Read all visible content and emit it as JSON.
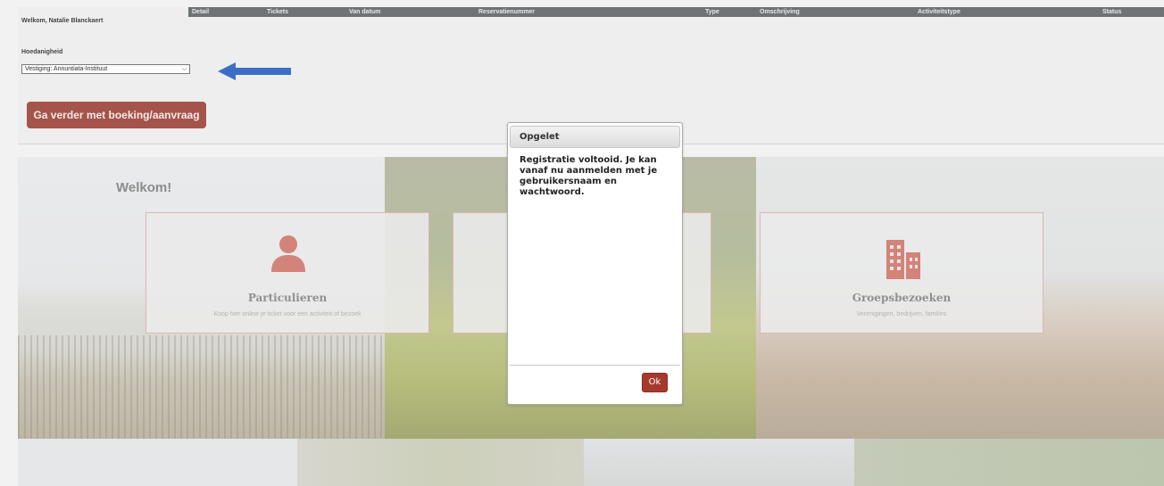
{
  "header": {
    "welcome": "Welkom, Natalie Blanckaert",
    "columns": [
      "Detail",
      "Tickets",
      "Van datum",
      "Reservatienummer",
      "Type",
      "Omschrijving",
      "Activiteitstype",
      "Status"
    ]
  },
  "form": {
    "quantity_label": "Hoedanigheid",
    "location_select": "Vestiging: Annuntiata-Instituut",
    "continue_label": "Ga verder met boeking/aanvraag"
  },
  "hero": {
    "welcome_title": "Welkom!",
    "cards": [
      {
        "title": "Particulieren",
        "subtitle": "Koop hier online je ticket voor een activiteit of bezoek"
      },
      {
        "title": "",
        "subtitle": ""
      },
      {
        "title": "Groepsbezoeken",
        "subtitle": "Verenigingen, bedrijven, families"
      }
    ]
  },
  "dialog": {
    "title": "Opgelet",
    "message": "Registratie voltooid. Je kan vanaf nu aanmelden met je gebruikersnaam en wachtwoord.",
    "ok_label": "Ok"
  },
  "icons": {
    "arrow": "arrow-left-icon",
    "person": "person-icon",
    "building": "building-icon",
    "chevron": "chevron-down-icon"
  },
  "colors": {
    "accent_button": "#a5544b",
    "ok_button": "#a6392d",
    "arrow": "#3b6fc6",
    "card_icon": "#d2837a",
    "table_header": "#6f7375"
  }
}
